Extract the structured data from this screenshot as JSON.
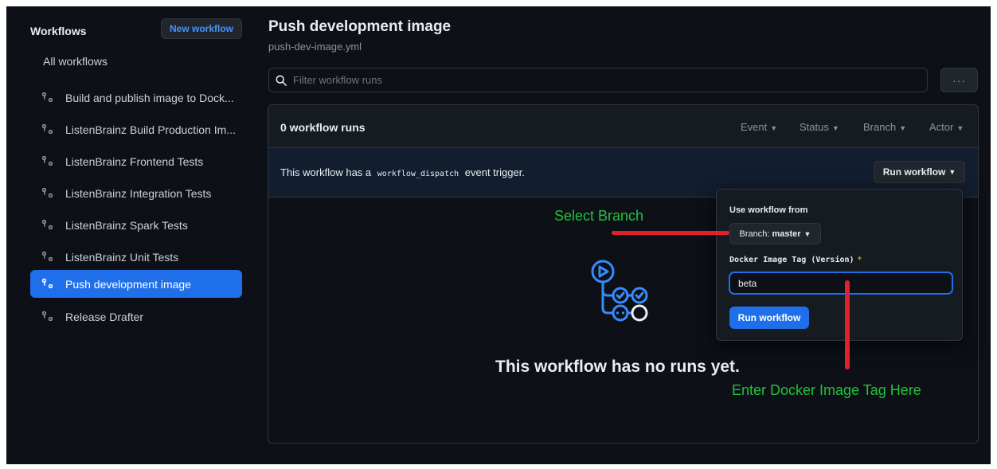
{
  "sidebar": {
    "title": "Workflows",
    "new_workflow_label": "New workflow",
    "all_workflows_label": "All workflows",
    "items": [
      {
        "label": "Build and publish image to Dock...",
        "icon": "workflow-icon"
      },
      {
        "label": "ListenBrainz Build Production Im...",
        "icon": "workflow-icon"
      },
      {
        "label": "ListenBrainz Frontend Tests",
        "icon": "workflow-icon"
      },
      {
        "label": "ListenBrainz Integration Tests",
        "icon": "workflow-icon"
      },
      {
        "label": "ListenBrainz Spark Tests",
        "icon": "workflow-icon"
      },
      {
        "label": "ListenBrainz Unit Tests",
        "icon": "workflow-icon"
      },
      {
        "label": "Push development image",
        "icon": "workflow-icon",
        "active": true
      },
      {
        "label": "Release Drafter",
        "icon": "workflow-icon"
      }
    ]
  },
  "header": {
    "title": "Push development image",
    "filename": "push-dev-image.yml"
  },
  "filter": {
    "placeholder": "Filter workflow runs",
    "icon": "search-icon"
  },
  "more_button": {
    "label": "···",
    "icon": "kebab-horizontal-icon"
  },
  "runs": {
    "count_label": "0 workflow runs",
    "filters": [
      "Event",
      "Status",
      "Branch",
      "Actor"
    ],
    "dispatch_prefix": "This workflow has a",
    "dispatch_code": "workflow_dispatch",
    "dispatch_suffix": "event trigger.",
    "run_workflow_label": "Run workflow",
    "empty_message": "This workflow has no runs yet."
  },
  "popover": {
    "use_workflow_from": "Use workflow from",
    "branch_prefix": "Branch:",
    "branch_value": "master",
    "tag_label": "Docker Image Tag (Version)",
    "required_mark": "*",
    "tag_value": "beta",
    "submit_label": "Run workflow"
  },
  "annotations": {
    "select_branch": "Select Branch",
    "enter_tag": "Enter Docker Image Tag Here",
    "text_color": "#24c13a",
    "line_color": "#e0202a"
  },
  "colors": {
    "background": "#0d1117",
    "accent": "#1f6feb",
    "link": "#4493f8"
  }
}
